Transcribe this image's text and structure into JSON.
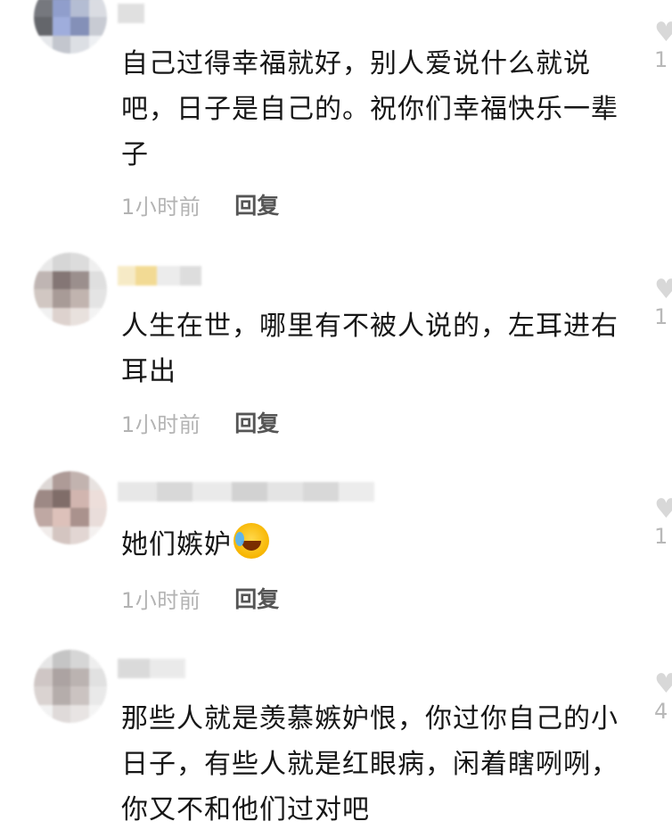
{
  "comments": [
    {
      "text": "自己过得幸福就好，别人爱说什么就说吧，日子是自己的。祝你们幸福快乐一辈子",
      "time": "1小时前",
      "reply": "回复",
      "like_count": "1"
    },
    {
      "text": "人生在世，哪里有不被人说的，左耳进右耳出",
      "time": "1小时前",
      "reply": "回复",
      "like_count": "1"
    },
    {
      "text": "她们嫉妒",
      "emoji": "laughing-crying-emoji",
      "time": "1小时前",
      "reply": "回复",
      "like_count": "1"
    },
    {
      "text": "那些人就是羡慕嫉妒恨，你过你自己的小日子，有些人就是红眼病，闲着瞎咧咧，你又不和他们过对吧",
      "like_count": "4"
    }
  ],
  "icons": {
    "like": "heart-icon"
  },
  "colors": {
    "meta_gray": "#b3b3b3",
    "reply_gray": "#555555",
    "like_gray": "#d8d8d8"
  }
}
